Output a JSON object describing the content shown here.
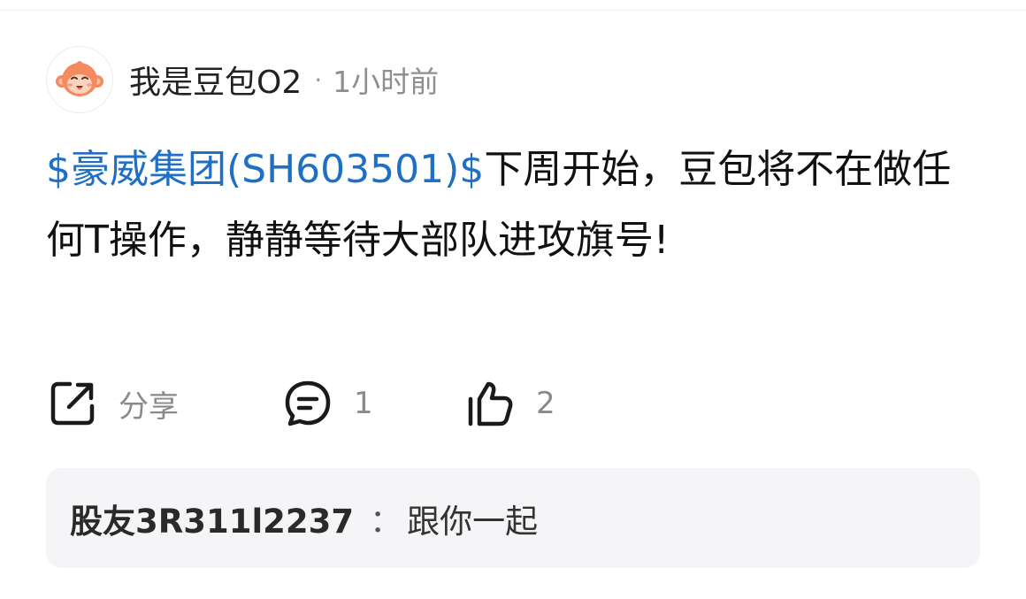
{
  "post": {
    "author": "我是豆包O2",
    "separator": "·",
    "time": "1小时前",
    "stock_tag": "$豪威集团(SH603501)$",
    "content": "下周开始，豆包将不在做任何T操作，静静等待大部队进攻旗号!"
  },
  "actions": {
    "share_label": "分享",
    "comment_count": "1",
    "like_count": "2",
    "icons": {
      "share": "share-icon",
      "comment": "comment-icon",
      "like": "thumbs-up-icon"
    }
  },
  "comment_preview": {
    "commenter": "股友3R311l2237",
    "separator": "：",
    "text": "跟你一起"
  },
  "colors": {
    "link": "#1f6fc5",
    "avatar_orange": "#f58a5e",
    "preview_bg": "#f5f5f7"
  }
}
